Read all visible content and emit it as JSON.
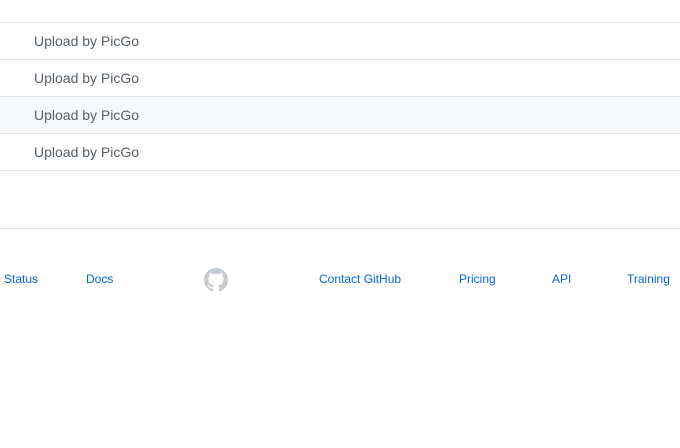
{
  "file_list": {
    "rows": [
      {
        "commit_message": "Upload by PicGo"
      },
      {
        "commit_message": "Upload by PicGo"
      },
      {
        "commit_message": "Upload by PicGo"
      },
      {
        "commit_message": "Upload by PicGo"
      }
    ]
  },
  "footer": {
    "links": {
      "status": "Status",
      "docs": "Docs",
      "contact": "Contact GitHub",
      "pricing": "Pricing",
      "api": "API",
      "training": "Training"
    },
    "logo_icon": "github-mark-icon"
  },
  "colors": {
    "link": "#0366d6",
    "text_muted": "#586069",
    "border": "#e1e4e8",
    "row_hover": "#f6f8fa",
    "logo": "#c6cbd1"
  }
}
